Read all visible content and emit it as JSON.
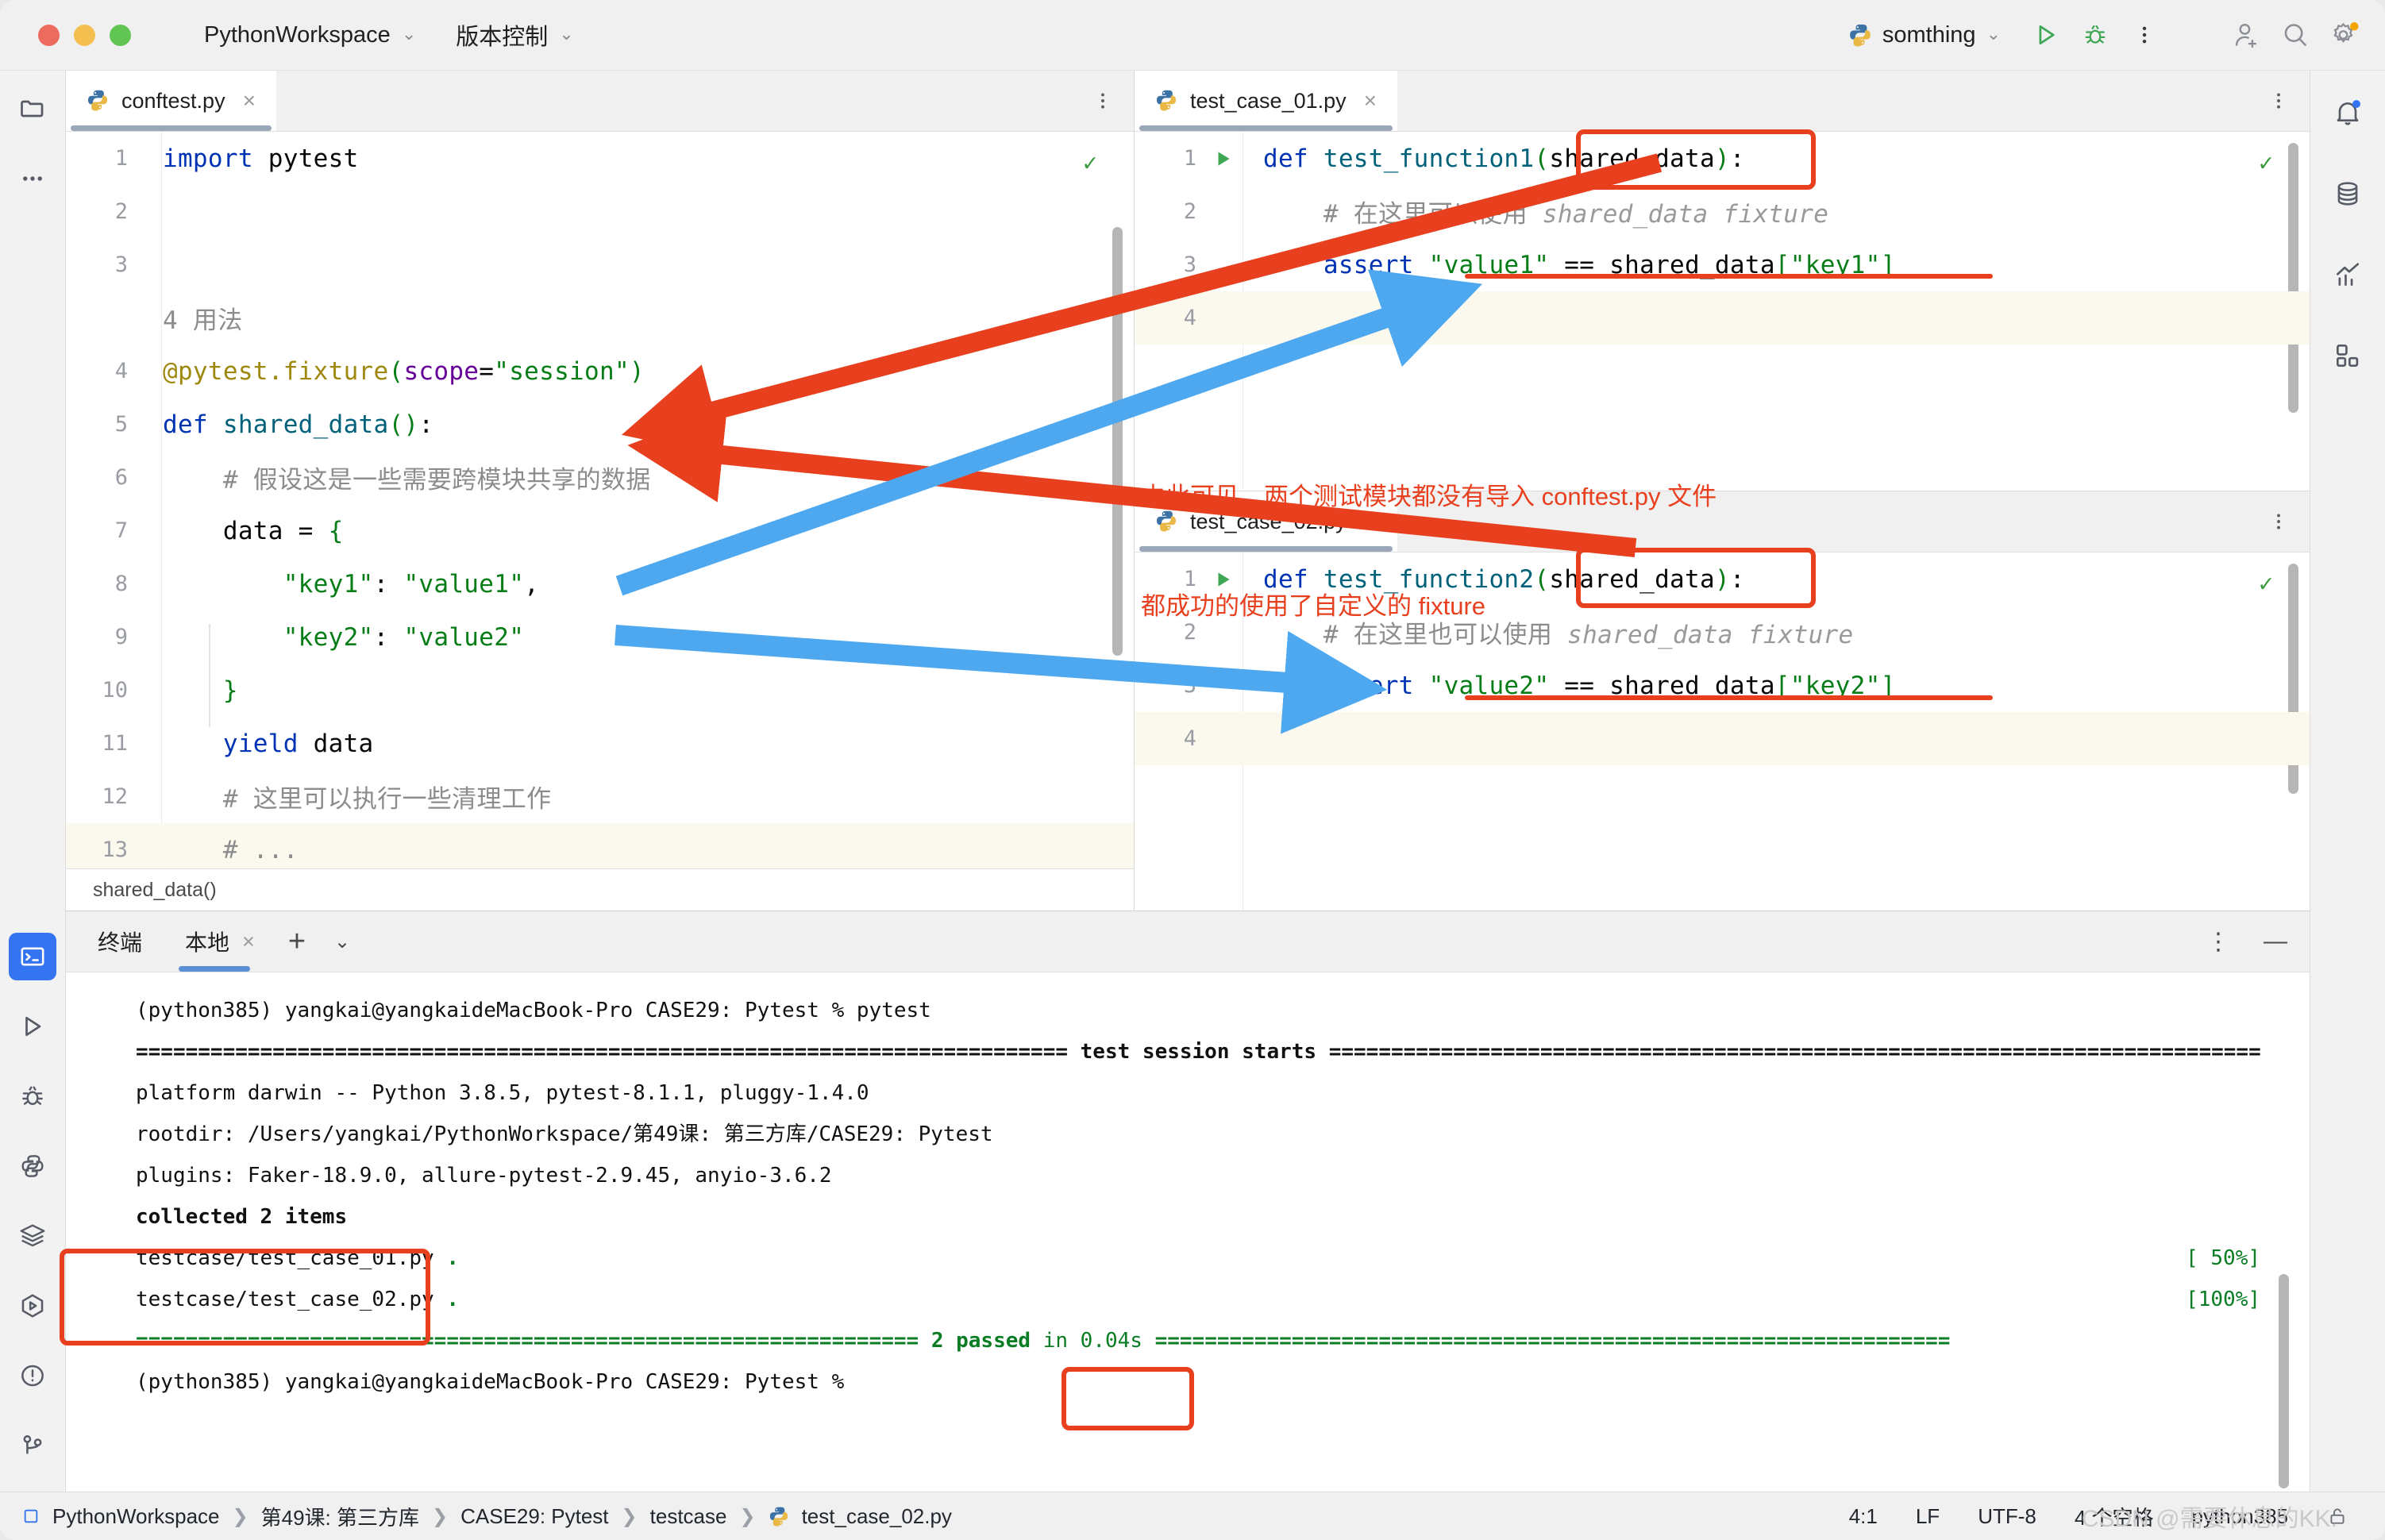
{
  "titlebar": {
    "project": "PythonWorkspace",
    "vcs": "版本控制",
    "run_config": "somthing",
    "icons": {
      "run": "run-icon",
      "debug": "debug-icon",
      "more": "more-vertical-icon",
      "add_user": "add-user-icon",
      "search": "search-icon",
      "settings": "gear-icon"
    }
  },
  "left_toolbar": {
    "items": [
      {
        "name": "project-folder-icon",
        "label": "项目"
      },
      {
        "name": "more-horizontal-icon",
        "label": "更多"
      },
      {
        "name": "terminal-icon",
        "label": "终端",
        "selected": true
      },
      {
        "name": "run-icon",
        "label": "运行"
      },
      {
        "name": "debug-icon",
        "label": "调试"
      },
      {
        "name": "python-console-icon",
        "label": "Python 控制台"
      },
      {
        "name": "services-icon",
        "label": "服务"
      },
      {
        "name": "test-runner-icon",
        "label": "测试"
      },
      {
        "name": "problems-icon",
        "label": "问题"
      },
      {
        "name": "version-control-icon",
        "label": "版本控制"
      }
    ]
  },
  "right_toolbar": {
    "items": [
      {
        "name": "notifications-bell-icon",
        "badge": true
      },
      {
        "name": "database-icon",
        "badge": false
      },
      {
        "name": "profiler-chart-icon",
        "badge": false
      },
      {
        "name": "plugins-grid-icon",
        "badge": false
      }
    ]
  },
  "left_editor": {
    "tab": {
      "filename": "conftest.py",
      "icon": "python-file-icon",
      "close": "×"
    },
    "breadcrumb": "shared_data()",
    "inspection_ok": "✓",
    "lines": [
      {
        "n": "1",
        "tokens": [
          {
            "t": "import",
            "c": "k"
          },
          {
            "t": " pytest",
            "c": ""
          }
        ]
      },
      {
        "n": "2",
        "tokens": []
      },
      {
        "n": "3",
        "tokens": []
      },
      {
        "n": "",
        "tokens": [
          {
            "t": "4 用法",
            "c": "cm"
          }
        ],
        "annotation_row": true
      },
      {
        "n": "4",
        "tokens": [
          {
            "t": "@pytest.fixture",
            "c": "dec"
          },
          {
            "t": "(",
            "c": "par"
          },
          {
            "t": "scope",
            "c": "kw-arg"
          },
          {
            "t": "=",
            "c": ""
          },
          {
            "t": "\"session\"",
            "c": "s"
          },
          {
            "t": ")",
            "c": "par"
          }
        ]
      },
      {
        "n": "5",
        "tokens": [
          {
            "t": "def ",
            "c": "k"
          },
          {
            "t": "shared_data",
            "c": "fn"
          },
          {
            "t": "()",
            "c": "par"
          },
          {
            "t": ":",
            "c": ""
          }
        ]
      },
      {
        "n": "6",
        "tokens": [
          {
            "t": "    # 假设这是一些需要跨模块共享的数据",
            "c": "cm"
          }
        ]
      },
      {
        "n": "7",
        "tokens": [
          {
            "t": "    data = ",
            "c": ""
          },
          {
            "t": "{",
            "c": "par"
          }
        ]
      },
      {
        "n": "8",
        "tokens": [
          {
            "t": "        ",
            "c": ""
          },
          {
            "t": "\"key1\"",
            "c": "s"
          },
          {
            "t": ": ",
            "c": ""
          },
          {
            "t": "\"value1\"",
            "c": "s"
          },
          {
            "t": ",",
            "c": ""
          }
        ]
      },
      {
        "n": "9",
        "tokens": [
          {
            "t": "        ",
            "c": ""
          },
          {
            "t": "\"key2\"",
            "c": "s"
          },
          {
            "t": ": ",
            "c": ""
          },
          {
            "t": "\"value2\"",
            "c": "s"
          }
        ]
      },
      {
        "n": "10",
        "tokens": [
          {
            "t": "    ",
            "c": ""
          },
          {
            "t": "}",
            "c": "par"
          }
        ]
      },
      {
        "n": "11",
        "tokens": [
          {
            "t": "    yield",
            "c": "k"
          },
          {
            "t": " data",
            "c": ""
          }
        ]
      },
      {
        "n": "12",
        "tokens": [
          {
            "t": "    # 这里可以执行一些清理工作",
            "c": "cm"
          }
        ]
      },
      {
        "n": "13",
        "tokens": [
          {
            "t": "    # ...",
            "c": "cm"
          }
        ],
        "highlight": true
      }
    ]
  },
  "right_editor_top": {
    "tab": {
      "filename": "test_case_01.py",
      "icon": "python-file-icon",
      "close": "×"
    },
    "inspection_ok": "✓",
    "lines": [
      {
        "n": "1",
        "run": true,
        "tokens": [
          {
            "t": "def ",
            "c": "k"
          },
          {
            "t": "test_function1",
            "c": "fn"
          },
          {
            "t": "(",
            "c": "par"
          },
          {
            "t": "shared_data",
            "c": ""
          },
          {
            "t": ")",
            "c": "par"
          },
          {
            "t": ":",
            "c": ""
          }
        ]
      },
      {
        "n": "2",
        "run": false,
        "tokens": [
          {
            "t": "    # 在这里可以使用 ",
            "c": "cm"
          },
          {
            "t": "shared_data fixture",
            "c": "cmi"
          }
        ]
      },
      {
        "n": "3",
        "run": false,
        "tokens": [
          {
            "t": "    assert",
            "c": "k"
          },
          {
            "t": " ",
            "c": ""
          },
          {
            "t": "\"value1\"",
            "c": "s"
          },
          {
            "t": " == shared_data",
            "c": ""
          },
          {
            "t": "[",
            "c": "par"
          },
          {
            "t": "\"key1\"",
            "c": "s"
          },
          {
            "t": "]",
            "c": "par"
          }
        ]
      },
      {
        "n": "4",
        "run": false,
        "tokens": [],
        "highlight": true
      }
    ]
  },
  "right_editor_bottom": {
    "tab": {
      "filename": "test_case_02.py",
      "icon": "python-file-icon",
      "close": "×"
    },
    "inspection_ok": "✓",
    "lines": [
      {
        "n": "1",
        "run": true,
        "tokens": [
          {
            "t": "def ",
            "c": "k"
          },
          {
            "t": "test_function2",
            "c": "fn"
          },
          {
            "t": "(",
            "c": "par"
          },
          {
            "t": "shared_data",
            "c": ""
          },
          {
            "t": ")",
            "c": "par"
          },
          {
            "t": ":",
            "c": ""
          }
        ]
      },
      {
        "n": "2",
        "run": false,
        "tokens": [
          {
            "t": "    # 在这里也可以使用 ",
            "c": "cm"
          },
          {
            "t": "shared_data fixture",
            "c": "cmi"
          }
        ]
      },
      {
        "n": "3",
        "run": false,
        "tokens": [
          {
            "t": "    assert",
            "c": "k"
          },
          {
            "t": " ",
            "c": ""
          },
          {
            "t": "\"value2\"",
            "c": "s"
          },
          {
            "t": " == shared_data",
            "c": ""
          },
          {
            "t": "[",
            "c": "par"
          },
          {
            "t": "\"key2\"",
            "c": "s"
          },
          {
            "t": "]",
            "c": "par"
          }
        ]
      },
      {
        "n": "4",
        "run": false,
        "tokens": [],
        "highlight": true
      }
    ]
  },
  "annotation": {
    "line1": "由此可见，两个测试模块都没有导入 conftest.py 文件",
    "line2": "都成功的使用了自定义的 fixture",
    "color": "#e8401f",
    "arrow_color_blue": "#4ea8ef"
  },
  "terminal": {
    "title": "终端",
    "tab": "本地",
    "tab_close": "×",
    "plus": "+",
    "chevron": "⌄",
    "more": "⋮",
    "minimize": "—",
    "lines": [
      {
        "text": "(python385) yangkai@yangkaideMacBook-Pro CASE29: Pytest % pytest",
        "style": "plain"
      },
      {
        "text": "=========================================================================== test session starts ===========================================================================",
        "style": "bold"
      },
      {
        "text": "platform darwin -- Python 3.8.5, pytest-8.1.1, pluggy-1.4.0",
        "style": "plain"
      },
      {
        "text": "rootdir: /Users/yangkai/PythonWorkspace/第49课: 第三方库/CASE29: Pytest",
        "style": "plain"
      },
      {
        "text": "plugins: Faker-18.9.0, allure-pytest-2.9.45, anyio-3.6.2",
        "style": "plain"
      },
      {
        "text": "collected 2 items",
        "style": "bold"
      },
      {
        "text": "",
        "style": "plain"
      },
      {
        "text": "testcase/test_case_01.py .",
        "style": "plain",
        "pct": "[ 50%]"
      },
      {
        "text": "testcase/test_case_02.py .",
        "style": "plain",
        "pct": "[100%]"
      },
      {
        "text": "",
        "style": "plain"
      },
      {
        "text": "",
        "style": "plain"
      },
      {
        "text": "=============================================================== 2 passed in 0.04s ================================================================",
        "style": "green-summary"
      },
      {
        "text": "(python385) yangkai@yangkaideMacBook-Pro CASE29: Pytest % ",
        "style": "plain"
      }
    ],
    "summary": {
      "prefix": "=============================================================== ",
      "passed": "2 passed",
      "mid": " in 0.04s ",
      "suffix": "================================================================"
    }
  },
  "statusbar": {
    "crumbs": [
      "PythonWorkspace",
      "第49课: 第三方库",
      "CASE29: Pytest",
      "testcase",
      "test_case_02.py"
    ],
    "separator": "❯",
    "caret": "4:1",
    "line_sep": "LF",
    "encoding": "UTF-8",
    "indent": "4 个空格",
    "interpreter": "python385",
    "lock_icon": "lock-icon"
  },
  "watermark": "CSDN @需要休息的KK."
}
